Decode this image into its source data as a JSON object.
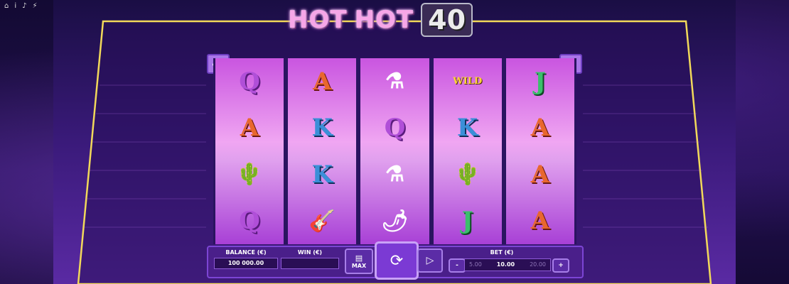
{
  "top_bar": {
    "icons": [
      "home-icon",
      "info-icon",
      "volume-icon",
      "lightning-icon"
    ],
    "glyphs": [
      "⌂",
      "i",
      "♪",
      "⚡"
    ]
  },
  "logo": {
    "word1": "HOT",
    "word2": "HOT",
    "number": "40"
  },
  "badges": {
    "left": "40",
    "right": "40"
  },
  "reels": [
    [
      "Q",
      "A",
      "cactus",
      "Q"
    ],
    [
      "A",
      "K",
      "K",
      "guitar"
    ],
    [
      "potion",
      "Q",
      "potion",
      "chili"
    ],
    [
      "wild",
      "K",
      "cactus",
      "J"
    ],
    [
      "J",
      "A",
      "A",
      "A"
    ]
  ],
  "symbols": {
    "Q": "Q",
    "A": "A",
    "K": "K",
    "J": "J",
    "cactus": "🌵",
    "guitar": "🎸",
    "potion": "⚗",
    "chili": "🌶",
    "wild": "WILD"
  },
  "panel": {
    "balance_label": "BALANCE (€)",
    "balance_value": "100 000.00",
    "win_label": "WIN (€)",
    "win_value": "",
    "max_label": "MAX",
    "bet_label": "BET (€)",
    "bet_prev": "5.00",
    "bet_current": "10.00",
    "bet_next": "20.00",
    "minus": "-",
    "plus": "+"
  }
}
